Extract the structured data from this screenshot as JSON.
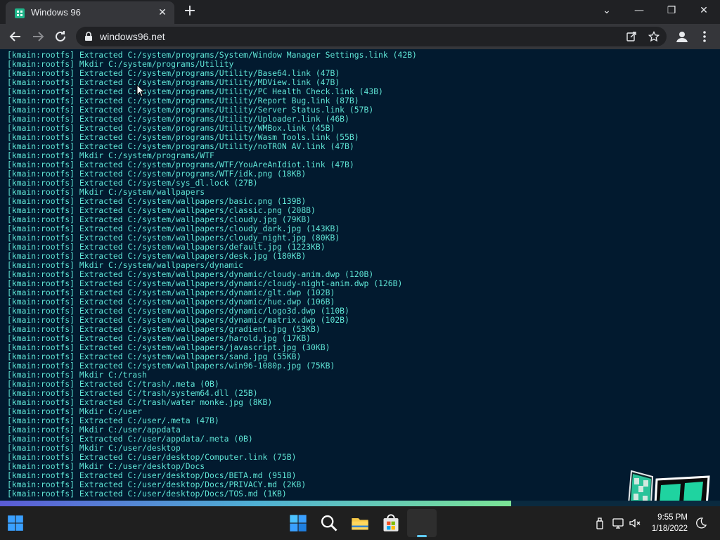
{
  "browser": {
    "tab_title": "Windows 96",
    "url": "windows96.net",
    "window_buttons": {
      "minimize": "—",
      "maximize": "❐",
      "close": "✕"
    }
  },
  "console": {
    "lines": [
      "[kmain:rootfs] Extracted C:/system/programs/System/Window Manager Settings.link (42B)",
      "[kmain:rootfs] Mkdir C:/system/programs/Utility",
      "[kmain:rootfs] Extracted C:/system/programs/Utility/Base64.link (47B)",
      "[kmain:rootfs] Extracted C:/system/programs/Utility/MDView.link (47B)",
      "[kmain:rootfs] Extracted C:/system/programs/Utility/PC Health Check.link (43B)",
      "[kmain:rootfs] Extracted C:/system/programs/Utility/Report Bug.link (87B)",
      "[kmain:rootfs] Extracted C:/system/programs/Utility/Server Status.link (57B)",
      "[kmain:rootfs] Extracted C:/system/programs/Utility/Uploader.link (46B)",
      "[kmain:rootfs] Extracted C:/system/programs/Utility/WMBox.link (45B)",
      "[kmain:rootfs] Extracted C:/system/programs/Utility/Wasm Tools.link (55B)",
      "[kmain:rootfs] Extracted C:/system/programs/Utility/noTRON AV.link (47B)",
      "[kmain:rootfs] Mkdir C:/system/programs/WTF",
      "[kmain:rootfs] Extracted C:/system/programs/WTF/YouAreAnIdiot.link (47B)",
      "[kmain:rootfs] Extracted C:/system/programs/WTF/idk.png (18KB)",
      "[kmain:rootfs] Extracted C:/system/sys_dl.lock (27B)",
      "[kmain:rootfs] Mkdir C:/system/wallpapers",
      "[kmain:rootfs] Extracted C:/system/wallpapers/basic.png (139B)",
      "[kmain:rootfs] Extracted C:/system/wallpapers/classic.png (208B)",
      "[kmain:rootfs] Extracted C:/system/wallpapers/cloudy.jpg (79KB)",
      "[kmain:rootfs] Extracted C:/system/wallpapers/cloudy_dark.jpg (143KB)",
      "[kmain:rootfs] Extracted C:/system/wallpapers/cloudy_night.jpg (80KB)",
      "[kmain:rootfs] Extracted C:/system/wallpapers/default.jpg (1223KB)",
      "[kmain:rootfs] Extracted C:/system/wallpapers/desk.jpg (180KB)",
      "[kmain:rootfs] Mkdir C:/system/wallpapers/dynamic",
      "[kmain:rootfs] Extracted C:/system/wallpapers/dynamic/cloudy-anim.dwp (120B)",
      "[kmain:rootfs] Extracted C:/system/wallpapers/dynamic/cloudy-night-anim.dwp (126B)",
      "[kmain:rootfs] Extracted C:/system/wallpapers/dynamic/glt.dwp (102B)",
      "[kmain:rootfs] Extracted C:/system/wallpapers/dynamic/hue.dwp (106B)",
      "[kmain:rootfs] Extracted C:/system/wallpapers/dynamic/logo3d.dwp (110B)",
      "[kmain:rootfs] Extracted C:/system/wallpapers/dynamic/matrix.dwp (102B)",
      "[kmain:rootfs] Extracted C:/system/wallpapers/gradient.jpg (53KB)",
      "[kmain:rootfs] Extracted C:/system/wallpapers/harold.jpg (17KB)",
      "[kmain:rootfs] Extracted C:/system/wallpapers/javascript.jpg (30KB)",
      "[kmain:rootfs] Extracted C:/system/wallpapers/sand.jpg (55KB)",
      "[kmain:rootfs] Extracted C:/system/wallpapers/win96-1080p.jpg (75KB)",
      "[kmain:rootfs] Mkdir C:/trash",
      "[kmain:rootfs] Extracted C:/trash/.meta (0B)",
      "[kmain:rootfs] Extracted C:/trash/system64.dll (25B)",
      "[kmain:rootfs] Extracted C:/trash/water monke.jpg (8KB)",
      "[kmain:rootfs] Mkdir C:/user",
      "[kmain:rootfs] Extracted C:/user/.meta (47B)",
      "[kmain:rootfs] Mkdir C:/user/appdata",
      "[kmain:rootfs] Extracted C:/user/appdata/.meta (0B)",
      "[kmain:rootfs] Mkdir C:/user/desktop",
      "[kmain:rootfs] Extracted C:/user/desktop/Computer.link (75B)",
      "[kmain:rootfs] Mkdir C:/user/desktop/Docs",
      "[kmain:rootfs] Extracted C:/user/desktop/Docs/BETA.md (951B)",
      "[kmain:rootfs] Extracted C:/user/desktop/Docs/PRIVACY.md (2KB)",
      "[kmain:rootfs] Extracted C:/user/desktop/Docs/TOS.md (1KB)"
    ]
  },
  "boot_progress": 0.71,
  "taskbar": {
    "time": "9:55 PM",
    "date": "1/18/2022"
  },
  "colors": {
    "console_bg": "#021a2f",
    "console_text": "#5fe5d6",
    "accent": "#60cdff"
  },
  "icons": [
    "windows96-favicon",
    "back-arrow-icon",
    "forward-arrow-icon",
    "reload-icon",
    "lock-icon",
    "share-icon",
    "star-icon",
    "profile-icon",
    "kebab-menu-icon",
    "windows-start-icon",
    "search-icon",
    "file-explorer-icon",
    "store-icon",
    "usb-icon",
    "network-icon",
    "volume-muted-icon",
    "focus-moon-icon"
  ]
}
